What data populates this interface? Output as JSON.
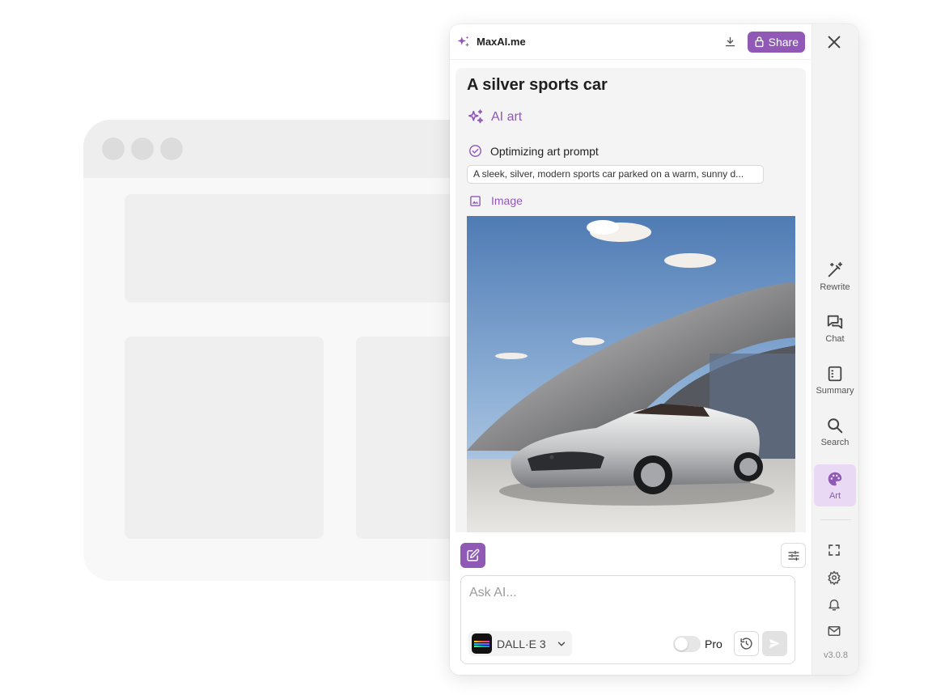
{
  "header": {
    "brand": "MaxAI.me",
    "share_label": "Share"
  },
  "content": {
    "title": "A silver sports car",
    "ai_art_label": "AI art",
    "step_label": "Optimizing art prompt",
    "prompt_text": "A sleek, silver, modern sports car parked on a warm, sunny d...",
    "image_label": "Image"
  },
  "composer": {
    "placeholder": "Ask AI...",
    "model": "DALL·E 3",
    "pro_label": "Pro"
  },
  "rail": {
    "items": [
      {
        "label": "Rewrite",
        "icon": "magic-wand-icon"
      },
      {
        "label": "Chat",
        "icon": "chat-icon"
      },
      {
        "label": "Summary",
        "icon": "summary-icon"
      },
      {
        "label": "Search",
        "icon": "search-icon"
      },
      {
        "label": "Art",
        "icon": "palette-icon",
        "active": true
      }
    ],
    "version": "v3.0.8"
  },
  "colors": {
    "accent": "#8f59b5",
    "active_bg": "#ead9f5"
  }
}
